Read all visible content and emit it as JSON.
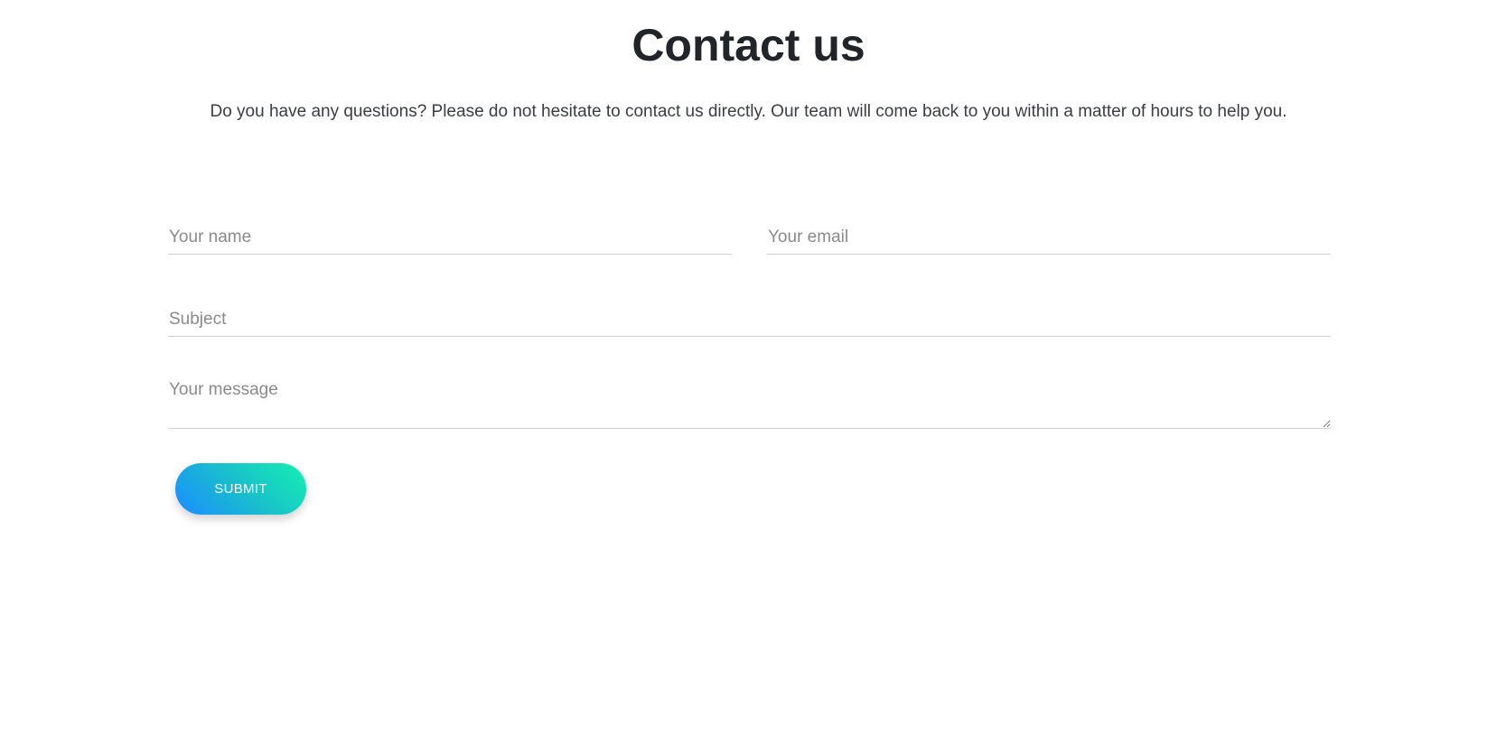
{
  "header": {
    "title": "Contact us",
    "intro": "Do you have any questions? Please do not hesitate to contact us directly. Our team will come back to you within a matter of hours to help you."
  },
  "form": {
    "name": {
      "value": "",
      "placeholder": "Your name"
    },
    "email": {
      "value": "",
      "placeholder": "Your email"
    },
    "subject": {
      "value": "",
      "placeholder": "Subject"
    },
    "message": {
      "value": "",
      "placeholder": "Your message"
    },
    "submit_label": "SUBMIT"
  },
  "colors": {
    "title_text": "#212529",
    "gradient_start": "#1a8cff",
    "gradient_end": "#14f0b0",
    "field_border": "#cfcfcf"
  }
}
